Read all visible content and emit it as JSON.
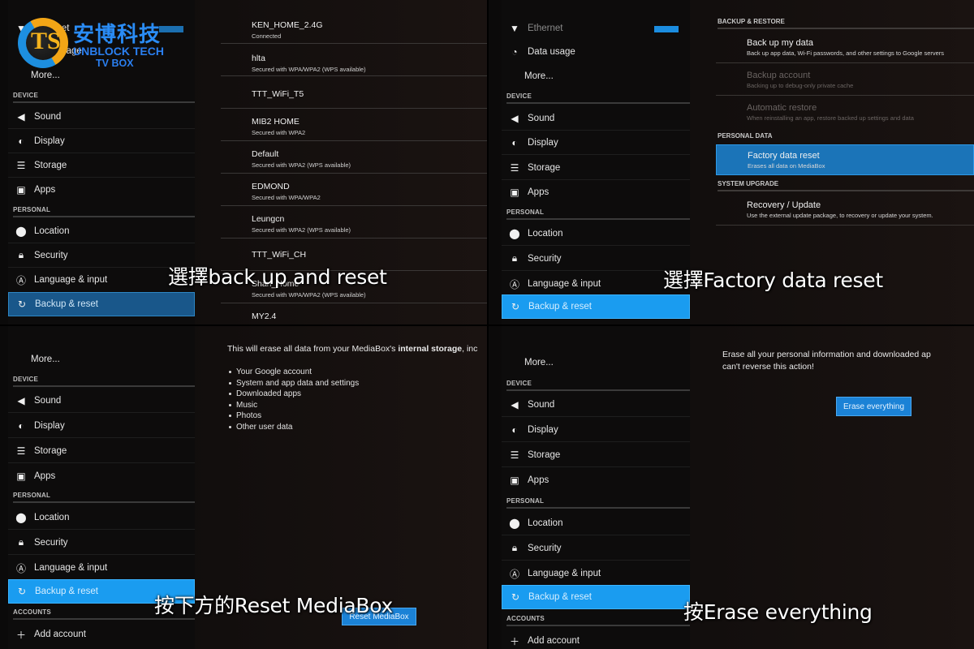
{
  "watermark": {
    "cn": "安博科技",
    "en_line1": "UNBLOCK TECH",
    "en_line2": "TV BOX"
  },
  "sidebar": {
    "ethernet": "Ethernet",
    "data_usage": "Data usage",
    "more": "More...",
    "device_header": "DEVICE",
    "sound": "Sound",
    "display": "Display",
    "storage": "Storage",
    "apps": "Apps",
    "personal_header": "PERSONAL",
    "location": "Location",
    "security": "Security",
    "language": "Language & input",
    "backup": "Backup & reset",
    "accounts_header": "ACCOUNTS",
    "add_account": "Add account",
    "toggle_state": "ON"
  },
  "step1": {
    "wifi_networks": [
      {
        "ssid": "KEN_HOME_2.4G",
        "status": "Connected"
      },
      {
        "ssid": "hlta",
        "status": "Secured with WPA/WPA2 (WPS available)"
      },
      {
        "ssid": "TTT_WiFi_T5",
        "status": ""
      },
      {
        "ssid": "MIB2 HOME",
        "status": "Secured with WPA2"
      },
      {
        "ssid": "Default",
        "status": "Secured with WPA2 (WPS available)"
      },
      {
        "ssid": "EDMOND",
        "status": "Secured with WPA/WPA2"
      },
      {
        "ssid": "Leungcn",
        "status": "Secured with WPA2 (WPS available)"
      },
      {
        "ssid": "TTT_WiFi_CH",
        "status": ""
      },
      {
        "ssid": "Shan_Home",
        "status": "Secured with WPA/WPA2 (WPS available)"
      },
      {
        "ssid": "MY2.4",
        "status": ""
      }
    ],
    "subtitle": "選擇back up and reset"
  },
  "step2": {
    "backup_restore_header": "BACKUP & RESTORE",
    "backup_my_data": {
      "title": "Back up my data",
      "summary": "Back up app data, Wi-Fi passwords, and other settings to Google servers"
    },
    "backup_account": {
      "title": "Backup account",
      "summary": "Backing up to debug-only private cache"
    },
    "automatic_restore": {
      "title": "Automatic restore",
      "summary": "When reinstalling an app, restore backed up settings and data"
    },
    "personal_data_header": "PERSONAL DATA",
    "factory_reset": {
      "title": "Factory data reset",
      "summary": "Erases all data on MediaBox"
    },
    "system_upgrade_header": "SYSTEM UPGRADE",
    "recovery": {
      "title": "Recovery / Update",
      "summary": "Use the external update package, to recovery or update your system."
    },
    "subtitle": "選擇Factory data reset"
  },
  "step3": {
    "warning_prefix": "This will erase all data from your MediaBox's ",
    "warning_bold": "internal storage",
    "warning_suffix": ", inc",
    "items": [
      "Your Google account",
      "System and app data and settings",
      "Downloaded apps",
      "Music",
      "Photos",
      "Other user data"
    ],
    "reset_button": "Reset MediaBox",
    "subtitle": "按下方的Reset MediaBox"
  },
  "step4": {
    "line1": "Erase all your personal information and downloaded ap",
    "line2": "can't reverse this action!",
    "erase_button": "Erase everything",
    "subtitle": "按Erase everything"
  }
}
